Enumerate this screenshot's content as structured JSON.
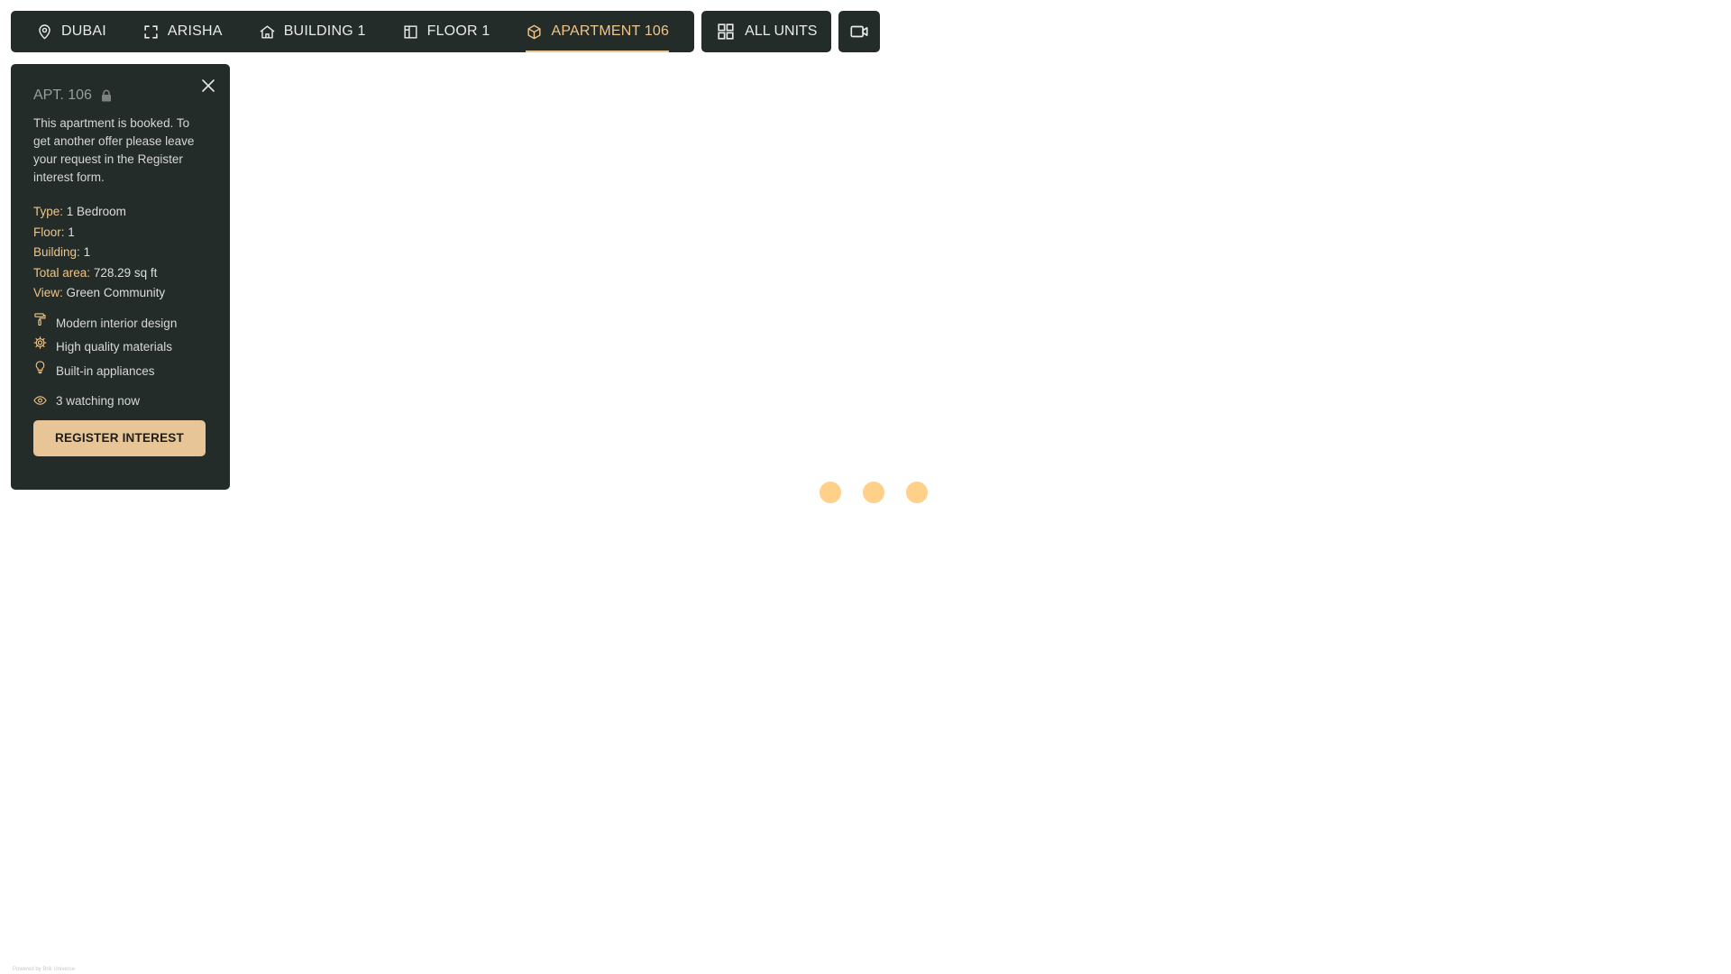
{
  "breadcrumb": {
    "items": [
      {
        "label": "DUBAI",
        "icon": "map-pin-icon"
      },
      {
        "label": "ARISHA",
        "icon": "expand-frame-icon"
      },
      {
        "label": "BUILDING 1",
        "icon": "home-icon"
      },
      {
        "label": "FLOOR 1",
        "icon": "floor-plan-icon"
      },
      {
        "label": "APARTMENT 106",
        "icon": "cube-icon",
        "active": true
      }
    ]
  },
  "toolbar": {
    "all_units_label": "ALL UNITS",
    "all_units_icon": "grid-icon",
    "video_icon": "video-camera-icon"
  },
  "panel": {
    "title": "APT. 106",
    "status_icon": "lock-icon",
    "description": "This apartment is booked. To get another offer please leave your request in the Register interest form.",
    "specs": [
      {
        "label": "Type:",
        "value": "1 Bedroom"
      },
      {
        "label": "Floor:",
        "value": "1"
      },
      {
        "label": "Building:",
        "value": "1"
      },
      {
        "label": "Total area:",
        "value": "728.29 sq ft"
      },
      {
        "label": "View:",
        "value": "Green Community"
      }
    ],
    "features": [
      {
        "label": "Modern interior design",
        "icon": "paint-roller-icon"
      },
      {
        "label": "High quality materials",
        "icon": "gear-icon"
      },
      {
        "label": "Built-in appliances",
        "icon": "lightbulb-icon"
      }
    ],
    "watching": "3 watching now",
    "register_label": "REGISTER INTEREST"
  },
  "footer": {
    "note": "Powered by Brik Universe"
  },
  "colors": {
    "panel_bg": "#232c29",
    "accent": "#f0c58a",
    "button": "#e8c597",
    "loader_dot": "#ffd08a"
  }
}
